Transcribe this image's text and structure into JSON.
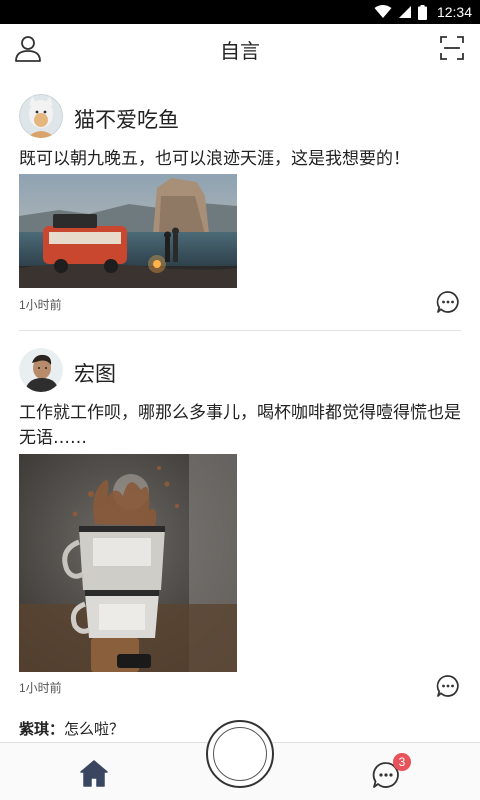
{
  "status_bar": {
    "time": "12:34",
    "icons": [
      "wifi-icon",
      "signal-icon",
      "battery-icon"
    ]
  },
  "header": {
    "title": "自言",
    "left_icon": "user-icon",
    "right_icon": "scan-icon"
  },
  "posts": [
    {
      "username": "猫不爱吃鱼",
      "text": "既可以朝九晚五，也可以浪迹天涯，这是我想要的！",
      "time": "1小时前",
      "photo": "camper van by the lake at dusk",
      "comment_icon": "comment-icon"
    },
    {
      "username": "宏图",
      "text": "工作就工作呗，哪那么多事儿，喝杯咖啡都觉得噎得慌也是无语……",
      "time": "1小时前",
      "photo": "stacked enamel coffee mugs with splash",
      "comment_icon": "comment-icon"
    }
  ],
  "comment": {
    "author": "紫琪：",
    "text": "怎么啦？"
  },
  "bottom_nav": {
    "home_icon": "home-icon",
    "messages_icon": "chat-icon",
    "messages_badge": "3",
    "center_button": "capture-button"
  },
  "colors": {
    "badge": "#e8525b",
    "status_bar": "#000000",
    "text": "#222222"
  }
}
